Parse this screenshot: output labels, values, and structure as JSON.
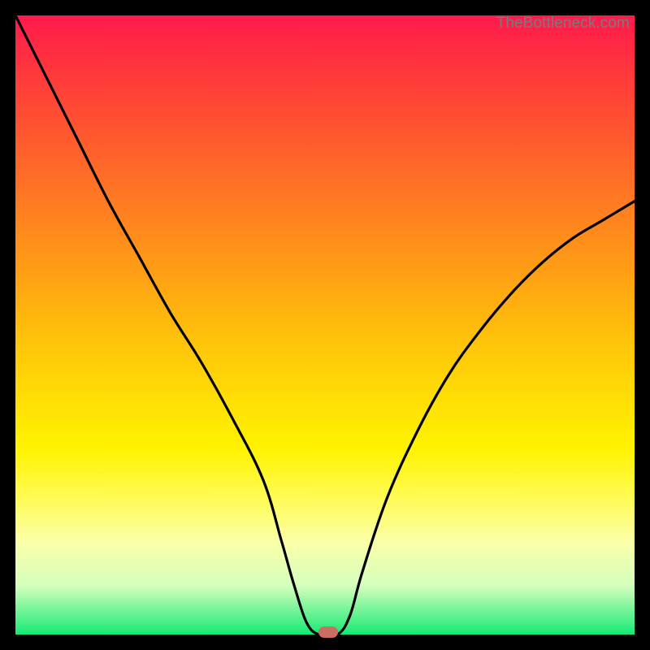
{
  "watermark": "TheBottleneck.com",
  "colors": {
    "frame": "#000000",
    "gradient_top": "#ff1a4d",
    "gradient_bottom": "#0fe874",
    "curve": "#000000",
    "marker": "#cc6d63"
  },
  "chart_data": {
    "type": "line",
    "title": "",
    "xlabel": "",
    "ylabel": "",
    "xlim": [
      0,
      100
    ],
    "ylim": [
      0,
      100
    ],
    "background": "gradient red→green (top→bottom)",
    "series": [
      {
        "name": "bottleneck-curve",
        "x": [
          0,
          5,
          10,
          15,
          20,
          25,
          30,
          35,
          40,
          43,
          45,
          47,
          49,
          52,
          54,
          56,
          60,
          65,
          70,
          75,
          80,
          85,
          90,
          95,
          100
        ],
        "y": [
          100,
          90,
          80,
          70,
          61,
          52,
          44,
          35,
          25,
          15,
          8,
          2,
          0,
          0,
          3,
          10,
          22,
          33,
          42,
          49,
          55,
          60,
          64,
          67,
          70
        ]
      }
    ],
    "marker": {
      "x": 50.5,
      "y": 0
    }
  }
}
